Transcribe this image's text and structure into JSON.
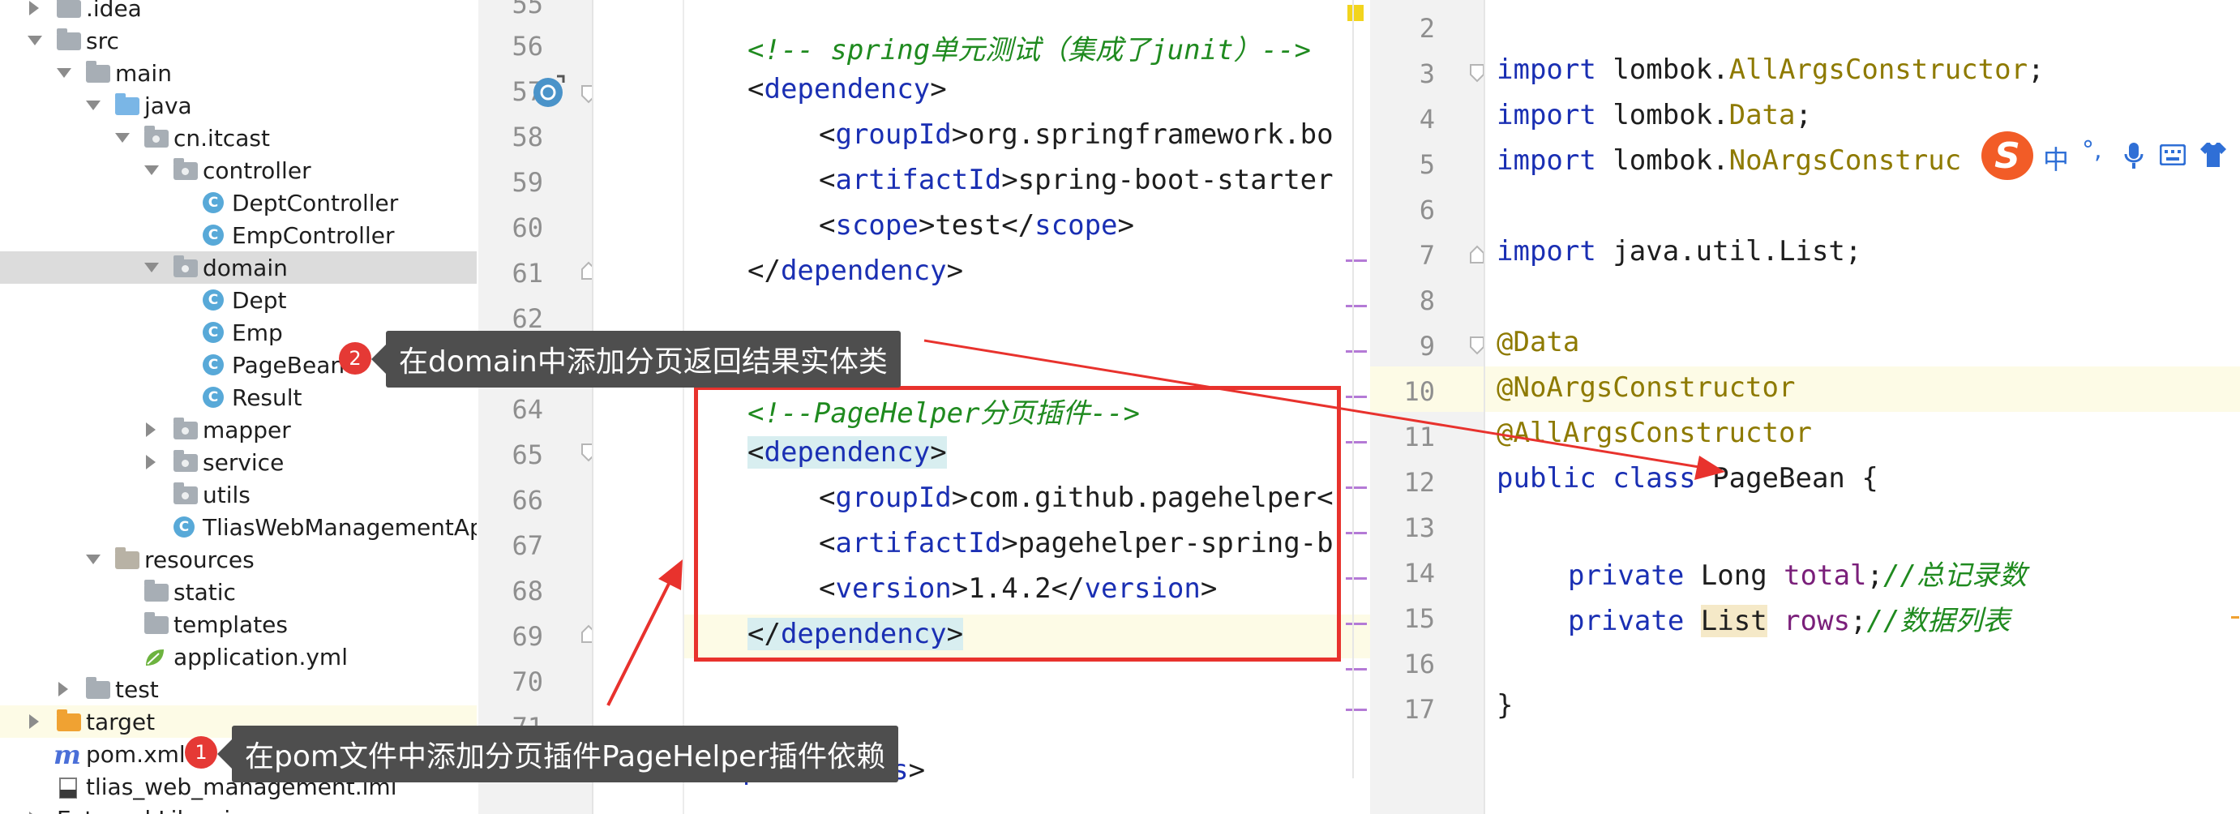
{
  "project_tree": {
    "items": [
      {
        "label": ".idea"
      },
      {
        "label": "src"
      },
      {
        "label": "main"
      },
      {
        "label": "java"
      },
      {
        "label": "cn.itcast"
      },
      {
        "label": "controller"
      },
      {
        "label": "DeptController"
      },
      {
        "label": "EmpController"
      },
      {
        "label": "domain"
      },
      {
        "label": "Dept"
      },
      {
        "label": "Emp"
      },
      {
        "label": "PageBean"
      },
      {
        "label": "Result"
      },
      {
        "label": "mapper"
      },
      {
        "label": "service"
      },
      {
        "label": "utils"
      },
      {
        "label": "TliasWebManagementAppl"
      },
      {
        "label": "resources"
      },
      {
        "label": "static"
      },
      {
        "label": "templates"
      },
      {
        "label": "application.yml"
      },
      {
        "label": "test"
      },
      {
        "label": "target"
      },
      {
        "label": "pom.xml"
      },
      {
        "label": "tlias_web_management.iml"
      },
      {
        "label": "External Librarie"
      }
    ],
    "class_icon": "C",
    "maven_icon": "m"
  },
  "annotations": [
    {
      "number": "2",
      "text": "在domain中添加分页返回结果实体类"
    },
    {
      "number": "1",
      "text": "在pom文件中添加分页插件PageHelper插件依赖"
    }
  ],
  "pom_editor": {
    "line_numbers": [
      "55",
      "56",
      "57",
      "58",
      "59",
      "60",
      "61",
      "62",
      "63",
      "64",
      "65",
      "66",
      "67",
      "68",
      "69",
      "70",
      "71",
      "72"
    ],
    "lines": {
      "l56": "<!-- spring单元测试（集成了junit）-->",
      "l57_open": "<",
      "l57_tag": "dependency",
      "l57_close": ">",
      "l58_tag": "groupId",
      "l58_val": "org.springframework.bo",
      "l59_tag": "artifactId",
      "l59_val": "spring-boot-starter",
      "l60_tag": "scope",
      "l60_val": "test",
      "l61_tag": "dependency",
      "l64": "<!--PageHelper分页插件-->",
      "l65_tag": "dependency",
      "l66_tag": "groupId",
      "l66_val": "com.github.pagehelper<",
      "l67_tag": "artifactId",
      "l67_val": "pagehelper-spring-b",
      "l68_tag": "version",
      "l68_val": "1.4.2",
      "l69_tag": "dependency",
      "l72_tag": "dependencies"
    }
  },
  "java_editor": {
    "line_numbers": [
      "2",
      "3",
      "4",
      "5",
      "6",
      "7",
      "8",
      "9",
      "10",
      "11",
      "12",
      "13",
      "14",
      "15",
      "16",
      "17"
    ],
    "lines": {
      "import_kw": "import",
      "l3_pkg": "lombok.",
      "l3_cls": "AllArgsConstructor",
      "semi": ";",
      "l4_cls": "Data",
      "l5_cls": "NoArgsConstruc",
      "l7_rest": "java.util.List;",
      "l9": "@Data",
      "l10": "@NoArgsConstructor",
      "l11": "@AllArgsConstructor",
      "l12_kw": "public class",
      "l12_name": "PageBean {",
      "private_kw": "private",
      "l14_type": "Long",
      "l14_field": "total",
      "l14_comment": "//总记录数",
      "l15_type": "List",
      "l15_field": "rows",
      "l15_comment": "//数据列表",
      "l17": "}"
    }
  },
  "ime_toolbar": {
    "logo": "S",
    "lang": "中",
    "punct": "°,",
    "icons": [
      "microphone-icon",
      "keyboard-icon",
      "skin-icon"
    ]
  },
  "colors": {
    "annotation_red": "#e8322d",
    "tooltip_bg": "#4e4e4e",
    "xml_tag": "#1a2fb3",
    "comment": "#1f8a1f",
    "annotation": "#8e7a00",
    "field": "#7a1f7a"
  }
}
